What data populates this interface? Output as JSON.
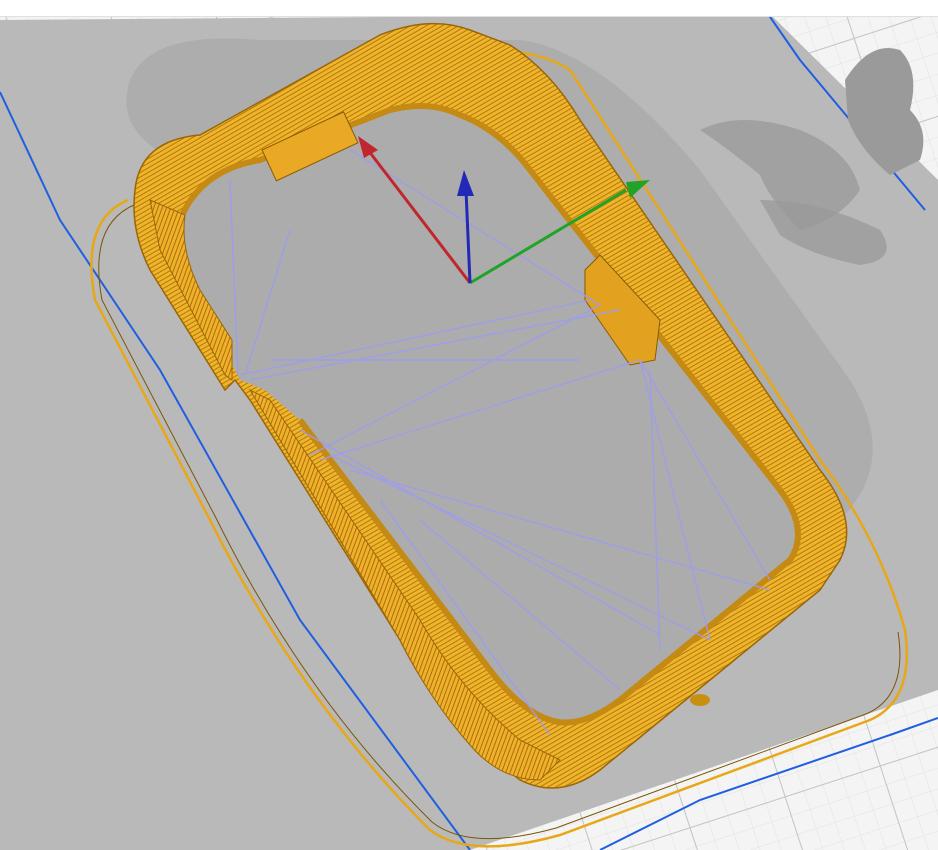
{
  "viewport": {
    "background": "#f2f2f2",
    "grid_major_color": "#c9c9c9",
    "grid_minor_color": "#e4e4e4",
    "bed_color": "#b5b5b5",
    "bed_outline_color": "#1f5fe0",
    "print_color": "#f0b42a",
    "print_dark": "#a8700c",
    "travel_color": "#9c9cf0",
    "logo_color": "#9a9a9a"
  },
  "axes": {
    "x_color": "#c0262d",
    "y_color": "#21a328",
    "z_color": "#2229b8"
  },
  "icons": {
    "build_plate": "build-plate",
    "logo": "printer-logo-watermark",
    "gizmo": "xyz-axis-gizmo"
  }
}
